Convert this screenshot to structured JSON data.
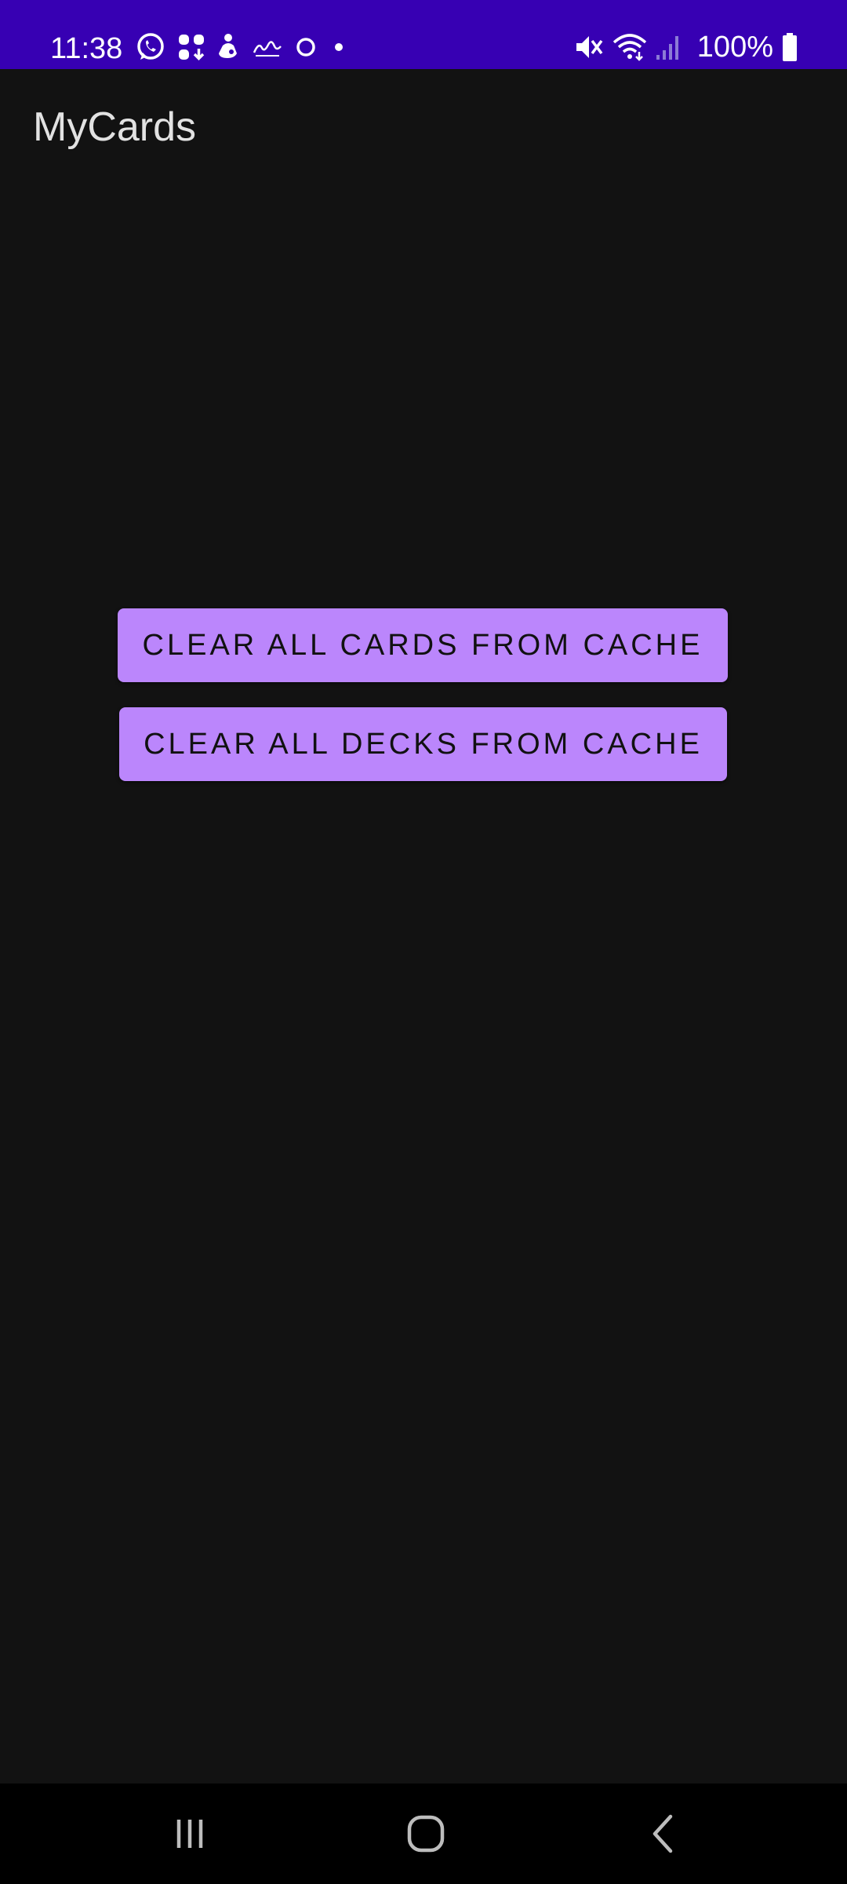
{
  "status_bar": {
    "time": "11:38",
    "battery_percent": "100%",
    "background_color": "#3700b3",
    "notification_icons": [
      "whatsapp-icon",
      "app-grid-icon",
      "person-icon",
      "scribble-icon",
      "circle-icon",
      "dot-icon"
    ],
    "system_icons": [
      "mute-icon",
      "wifi-icon",
      "signal-icon",
      "battery-icon"
    ]
  },
  "app_bar": {
    "title": "MyCards"
  },
  "main": {
    "buttons": [
      {
        "label": "CLEAR ALL CARDS FROM CACHE"
      },
      {
        "label": "CLEAR ALL DECKS FROM CACHE"
      }
    ],
    "button_color": "#bb86fc",
    "background_color": "#121212"
  },
  "nav_bar": {
    "icons": [
      "recents-icon",
      "home-icon",
      "back-icon"
    ]
  }
}
